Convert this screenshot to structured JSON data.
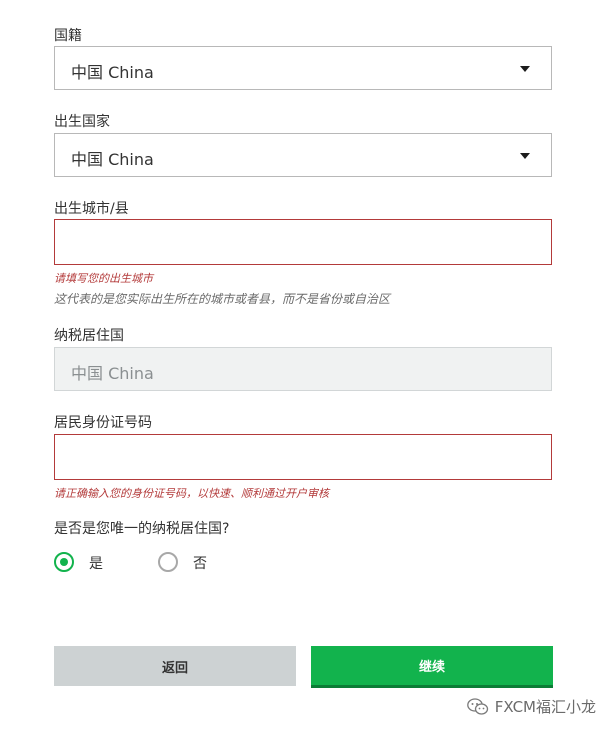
{
  "nationality": {
    "label": "国籍",
    "value": "中国 China"
  },
  "birth_country": {
    "label": "出生国家",
    "value": "中国 China"
  },
  "birth_city": {
    "label": "出生城市/县",
    "value": "",
    "error": "请填写您的出生城市",
    "help": "这代表的是您实际出生所在的城市或者县，而不是省份或自治区"
  },
  "tax_residence": {
    "label": "纳税居住国",
    "value": "中国 China"
  },
  "id_number": {
    "label": "居民身份证号码",
    "value": "",
    "error": "请正确输入您的身份证号码，以快速、顺利通过开户审核"
  },
  "only_tax_residence": {
    "question": "是否是您唯一的纳税居住国?",
    "options": [
      {
        "label": "是",
        "selected": true
      },
      {
        "label": "否",
        "selected": false
      }
    ]
  },
  "buttons": {
    "back": "返回",
    "continue": "继续"
  },
  "watermark": {
    "text": "FXCM福汇小龙",
    "icon": "wechat-icon"
  },
  "colors": {
    "accent": "#12b34d",
    "error": "#b33a3a"
  }
}
